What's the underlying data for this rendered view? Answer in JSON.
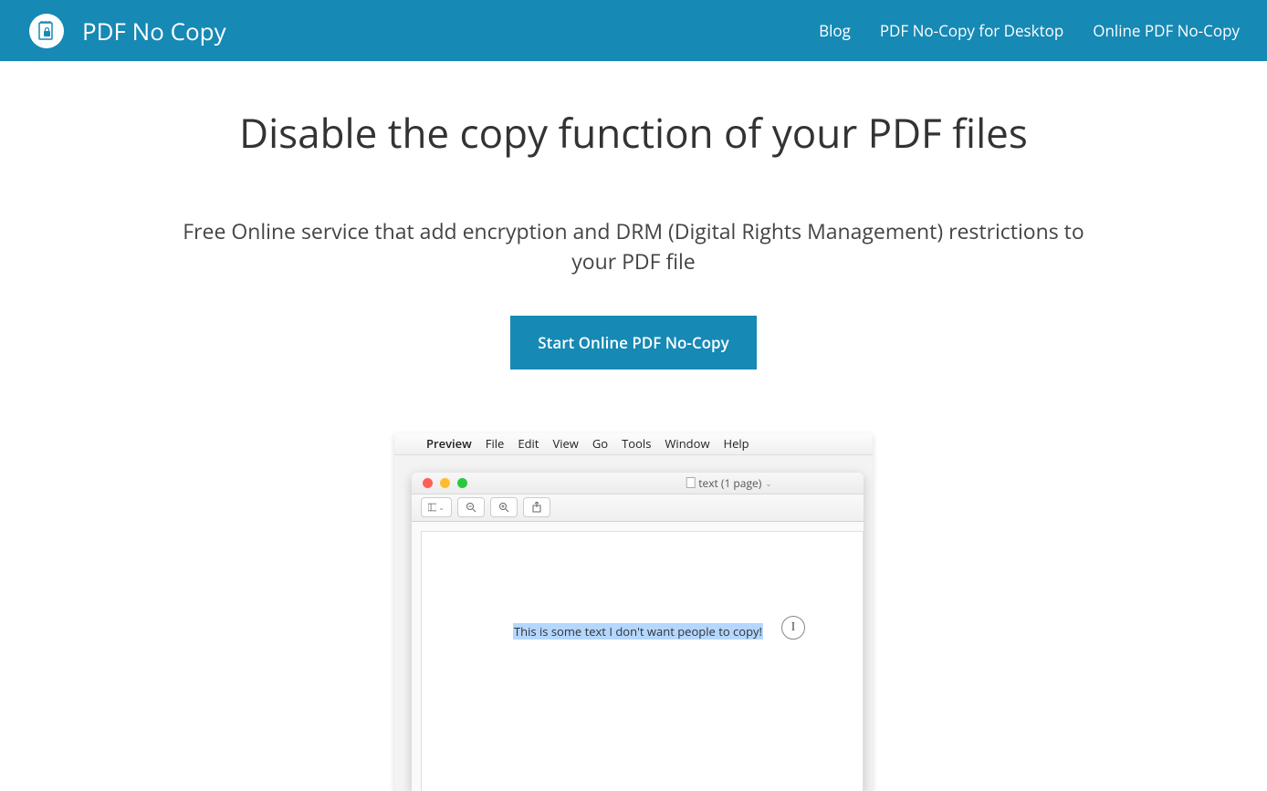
{
  "header": {
    "brand": "PDF No Copy",
    "nav": [
      "Blog",
      "PDF No-Copy for Desktop",
      "Online PDF No-Copy"
    ]
  },
  "hero": {
    "title": "Disable the copy function of your PDF files",
    "subtitle": "Free Online service that add encryption and DRM (Digital Rights Management) restrictions to your PDF file",
    "cta": "Start Online PDF No-Copy"
  },
  "demo": {
    "menubar": {
      "app": "Preview",
      "items": [
        "File",
        "Edit",
        "View",
        "Go",
        "Tools",
        "Window",
        "Help"
      ]
    },
    "window_title": "text (1 page)",
    "document_text": "This is some text I don't want people to copy!"
  }
}
